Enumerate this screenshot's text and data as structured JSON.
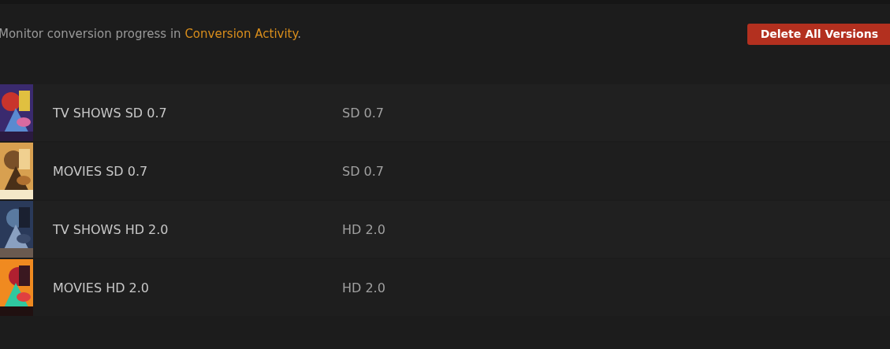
{
  "intro": {
    "text": "Monitor conversion progress in ",
    "link": "Conversion Activity",
    "after": "."
  },
  "delete_button": "Delete All Versions",
  "rows": [
    {
      "title": "TV SHOWS SD 0.7",
      "version": "SD 0.7"
    },
    {
      "title": "MOVIES SD 0.7",
      "version": "SD 0.7"
    },
    {
      "title": "TV SHOWS HD 2.0",
      "version": "HD 2.0"
    },
    {
      "title": "MOVIES HD 2.0",
      "version": "HD 2.0"
    }
  ]
}
